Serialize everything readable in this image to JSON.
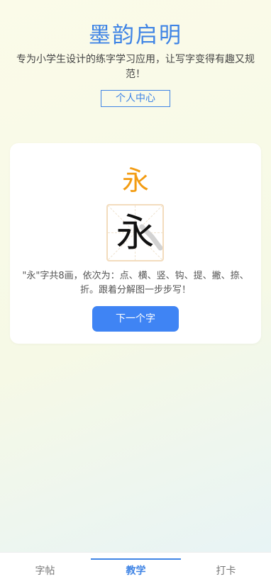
{
  "header": {
    "title": "墨韵启明",
    "subtitle": "专为小学生设计的练字学习应用，让写字变得有趣又规范！",
    "profile_button": "个人中心"
  },
  "lesson": {
    "character": "永",
    "grid_character": "永",
    "description": "\"永\"字共8画，依次为：点、横、竖、钩、提、撇、捺、折。跟着分解图一步步写！",
    "next_button": "下一个字"
  },
  "tabs": [
    {
      "label": "字帖",
      "active": false
    },
    {
      "label": "教学",
      "active": true
    },
    {
      "label": "打卡",
      "active": false
    }
  ],
  "colors": {
    "accent": "#3f84e5",
    "character_highlight": "#f39c12",
    "button_bg": "#3f84f4"
  }
}
